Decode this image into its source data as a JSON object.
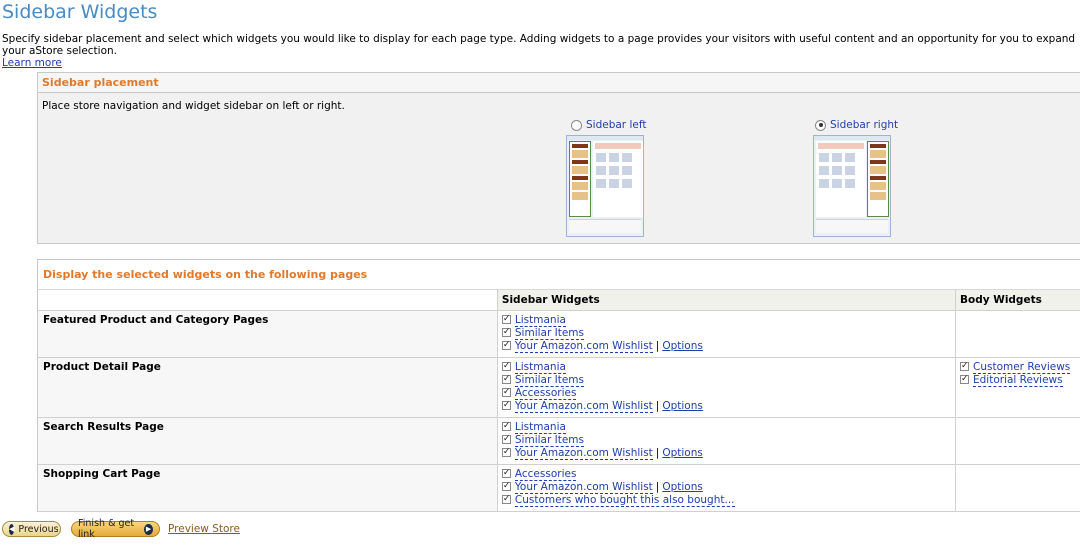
{
  "page": {
    "title": "Sidebar Widgets",
    "intro": "Specify sidebar placement and select which widgets you would like to display for each page type. Adding widgets to a page provides your visitors with useful content and an opportunity for you to expand your aStore selection.",
    "learn_more": "Learn more"
  },
  "placement": {
    "heading": "Sidebar placement",
    "description": "Place store navigation and widget sidebar on left or right.",
    "options": [
      {
        "label": "Sidebar left",
        "selected": false
      },
      {
        "label": "Sidebar right",
        "selected": true
      }
    ]
  },
  "widgets": {
    "heading": "Display the selected widgets on the following pages",
    "columns": {
      "sidebar": "Sidebar Widgets",
      "body": "Body Widgets"
    },
    "options_label": "Options",
    "rows": [
      {
        "page": "Featured Product and Category Pages",
        "sidebar": [
          {
            "label": "Listmania",
            "checked": true
          },
          {
            "label": "Similar Items",
            "checked": true
          },
          {
            "label": "Your Amazon.com Wishlist",
            "checked": true,
            "options": true
          }
        ],
        "body": []
      },
      {
        "page": "Product Detail Page",
        "sidebar": [
          {
            "label": "Listmania",
            "checked": true
          },
          {
            "label": "Similar Items",
            "checked": true
          },
          {
            "label": "Accessories",
            "checked": true
          },
          {
            "label": "Your Amazon.com Wishlist",
            "checked": true,
            "options": true
          }
        ],
        "body": [
          {
            "label": "Customer Reviews",
            "checked": true
          },
          {
            "label": "Editorial Reviews",
            "checked": true
          }
        ]
      },
      {
        "page": "Search Results Page",
        "sidebar": [
          {
            "label": "Listmania",
            "checked": true
          },
          {
            "label": "Similar Items",
            "checked": true
          },
          {
            "label": "Your Amazon.com Wishlist",
            "checked": true,
            "options": true
          }
        ],
        "body": []
      },
      {
        "page": "Shopping Cart Page",
        "sidebar": [
          {
            "label": "Accessories",
            "checked": true
          },
          {
            "label": "Your Amazon.com Wishlist",
            "checked": true,
            "options": true
          },
          {
            "label": "Customers who bought this also bought...",
            "checked": true
          }
        ],
        "body": []
      }
    ]
  },
  "footer": {
    "previous": "Previous",
    "finish": "Finish & get link",
    "preview": "Preview Store"
  },
  "colors": {
    "title": "#4a8ac4",
    "section_heading": "#e2792a",
    "link": "#1f3ea8"
  }
}
